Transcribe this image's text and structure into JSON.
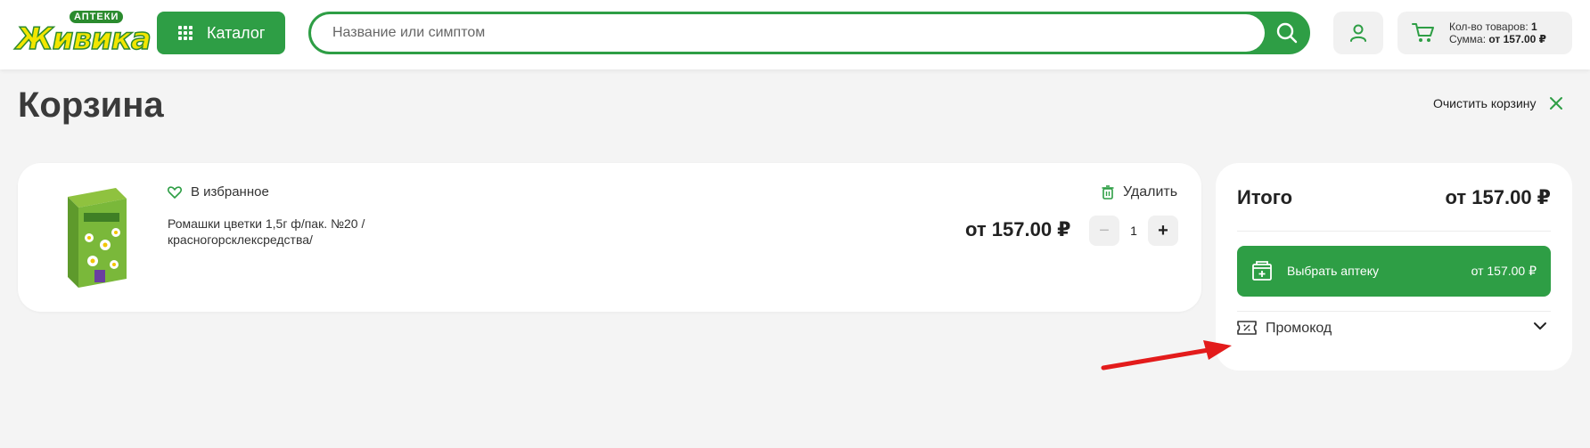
{
  "header": {
    "logo": {
      "top": "АПТЕКИ",
      "main": "Живика"
    },
    "catalog_label": "Каталог",
    "search": {
      "placeholder": "Название или симптом",
      "value": ""
    },
    "cart": {
      "count_label": "Кол-во товаров:",
      "count_value": "1",
      "sum_label": "Сумма:",
      "sum_value": "от 157.00 ₽"
    }
  },
  "page": {
    "title": "Корзина",
    "clear_cart_label": "Очистить корзину"
  },
  "cart_item": {
    "favorite_label": "В избранное",
    "name_line1": "Ромашки цветки 1,5г ф/пак. №20 /",
    "name_line2": "красногорсклексредства/",
    "delete_label": "Удалить",
    "price": "от 157.00 ₽",
    "quantity": "1",
    "minus": "−",
    "plus": "+"
  },
  "summary": {
    "title": "Итого",
    "total": "от 157.00 ₽",
    "choose_pharmacy_label": "Выбрать аптеку",
    "choose_pharmacy_price": "от 157.00 ₽",
    "promo_label": "Промокод"
  },
  "colors": {
    "brand_green": "#2e9e45",
    "annotation_arrow": "#e31b1b",
    "background": "#f4f4f4"
  }
}
